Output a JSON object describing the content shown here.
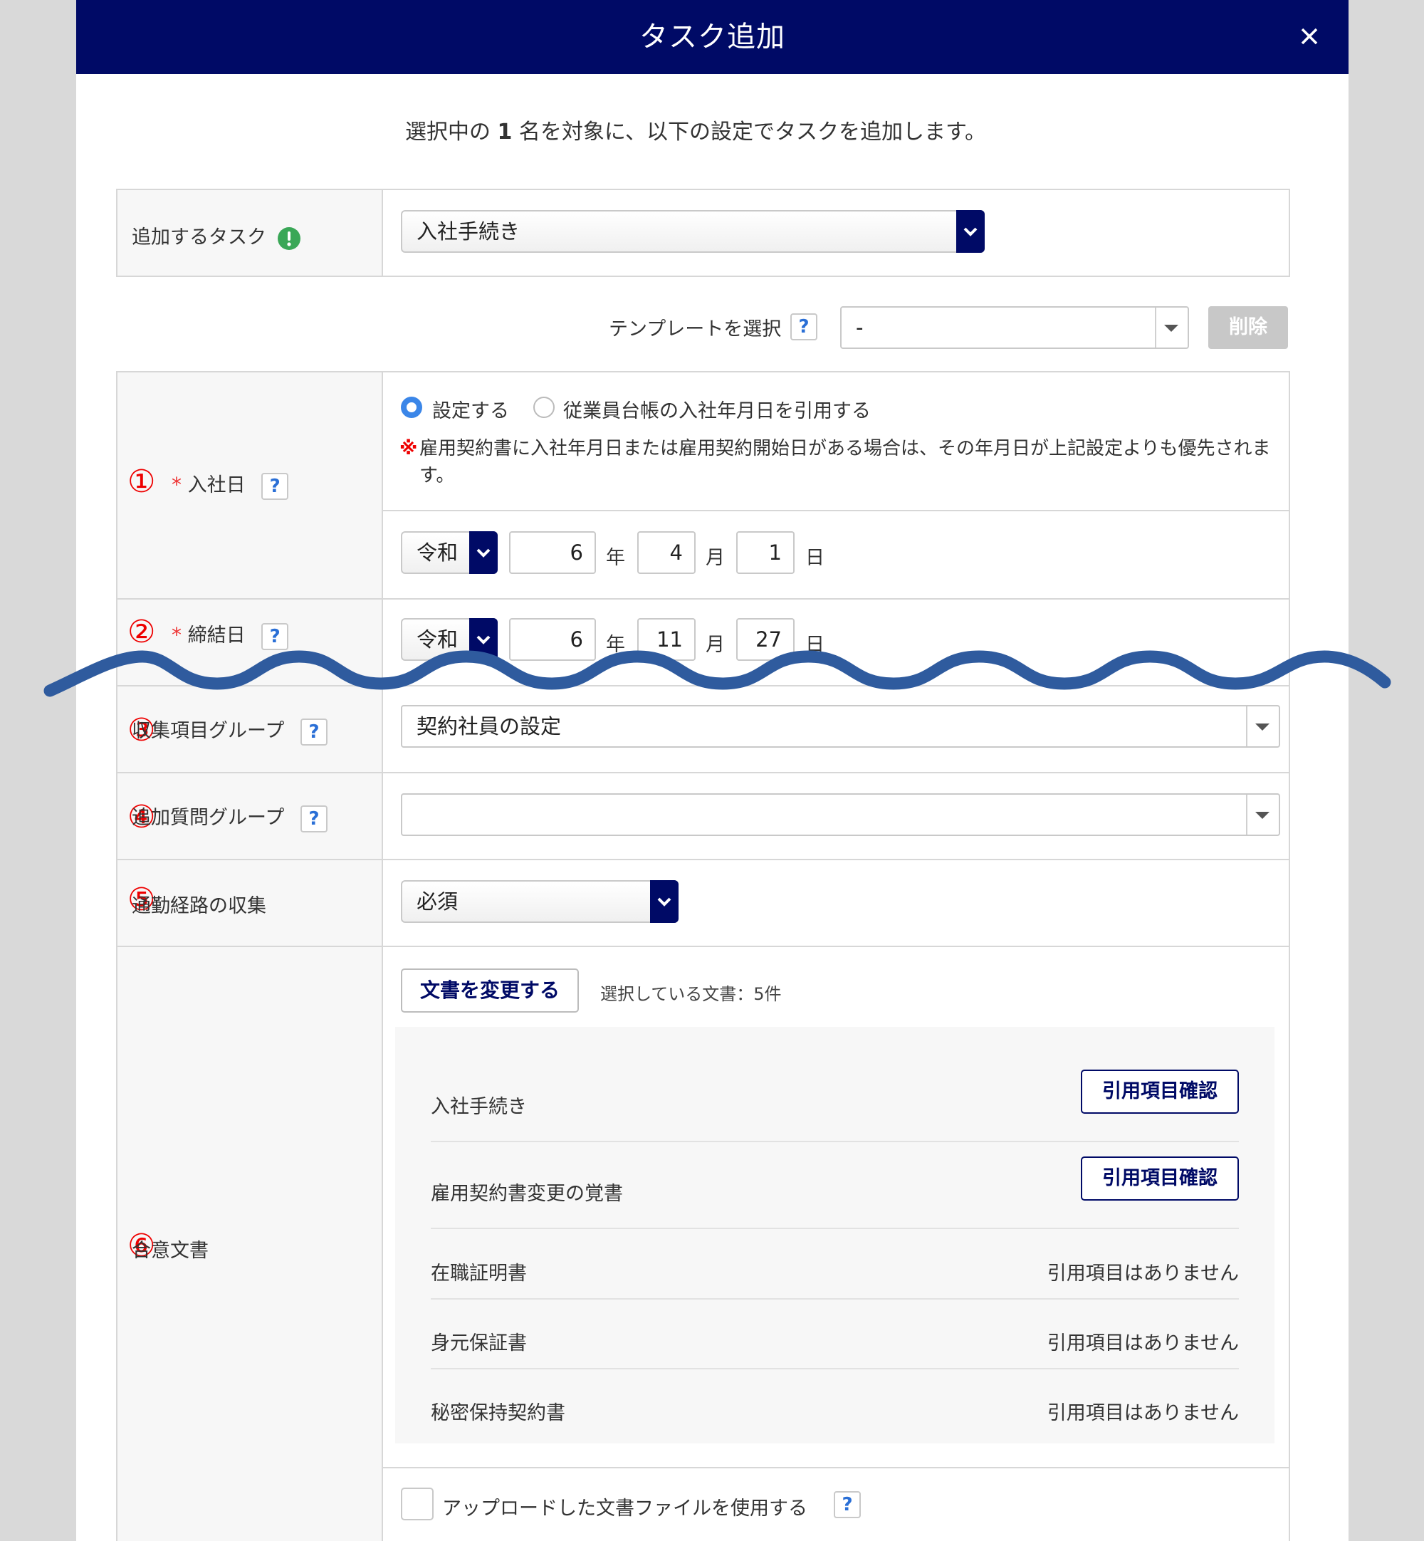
{
  "modal": {
    "title": "タスク追加",
    "intro_pre": "選択中の",
    "intro_count": "1",
    "intro_post": "名を対象に、以下の設定でタスクを追加します。"
  },
  "task": {
    "label": "追加するタスク",
    "value": "入社手続き"
  },
  "template": {
    "label": "テンプレートを選択",
    "value": "-",
    "delete_label": "削除"
  },
  "hire_date": {
    "num": "①",
    "label": "入社日",
    "radio_set": "設定する",
    "radio_quote": "従業員台帳の入社年月日を引用する",
    "note_mark": "※",
    "note": "雇用契約書に入社年月日または雇用契約開始日がある場合は、その年月日が上記設定よりも優先されます。",
    "era": "令和",
    "year": "6",
    "month": "4",
    "day": "1",
    "year_unit": "年",
    "month_unit": "月",
    "day_unit": "日"
  },
  "contract_date": {
    "num": "②",
    "label": "締結日",
    "era": "令和",
    "year": "6",
    "month": "11",
    "day": "27",
    "year_unit": "年",
    "month_unit": "月",
    "day_unit": "日"
  },
  "collect_group": {
    "num": "③",
    "label": "収集項目グループ",
    "value": "契約社員の設定"
  },
  "question_group": {
    "num": "④",
    "label": "追加質問グループ",
    "value": ""
  },
  "commute": {
    "num": "⑤",
    "label": "通勤経路の収集",
    "value": "必須"
  },
  "documents": {
    "num": "⑥",
    "label": "合意文書",
    "change_button": "文書を変更する",
    "selected_text": "選択している文書：5件",
    "items": [
      {
        "name": "入社手続き",
        "action": "引用項目確認"
      },
      {
        "name": "雇用契約書変更の覚書",
        "action": "引用項目確認"
      },
      {
        "name": "在職証明書",
        "status": "引用項目はありません"
      },
      {
        "name": "身元保証書",
        "status": "引用項目はありません"
      },
      {
        "name": "秘密保持契約書",
        "status": "引用項目はありません"
      }
    ],
    "upload_label": "アップロードした文書ファイルを使用する"
  },
  "required_mark": "*",
  "help_glyph": "?",
  "colors": {
    "header": "#000a66",
    "accent_red": "#e00000",
    "radio_blue": "#3b86e8",
    "info_green": "#3aa757",
    "wave_blue": "#2f5b9e"
  }
}
